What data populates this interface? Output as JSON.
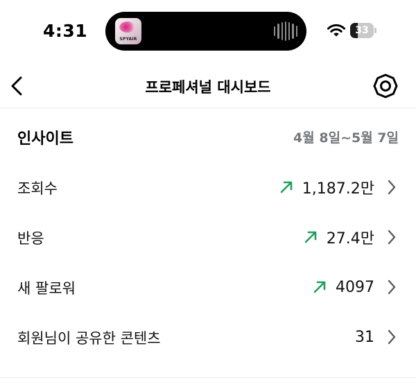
{
  "status_bar": {
    "time": "4:31",
    "battery_level": "33",
    "now_playing_art_label": "SPYAIR",
    "icons": [
      "waveform-icon",
      "wifi-icon",
      "battery-icon"
    ]
  },
  "header": {
    "title": "프로페셔널 대시보드",
    "icons": [
      "back-arrow-icon",
      "settings-gear-icon"
    ]
  },
  "insights": {
    "title": "인사이트",
    "date_range": "4월 8일~5월 7일",
    "metrics": [
      {
        "label": "조회수",
        "value": "1,187.2만",
        "trend": "up"
      },
      {
        "label": "반응",
        "value": "27.4만",
        "trend": "up"
      },
      {
        "label": "새 팔로워",
        "value": "4097",
        "trend": "up"
      },
      {
        "label": "회원님이 공유한 콘텐츠",
        "value": "31",
        "trend": ""
      }
    ]
  },
  "colors": {
    "trend_up": "#1f9e5c",
    "secondary_text": "#73777c",
    "divider": "#ececec",
    "chevron": "#5a5a5a"
  }
}
